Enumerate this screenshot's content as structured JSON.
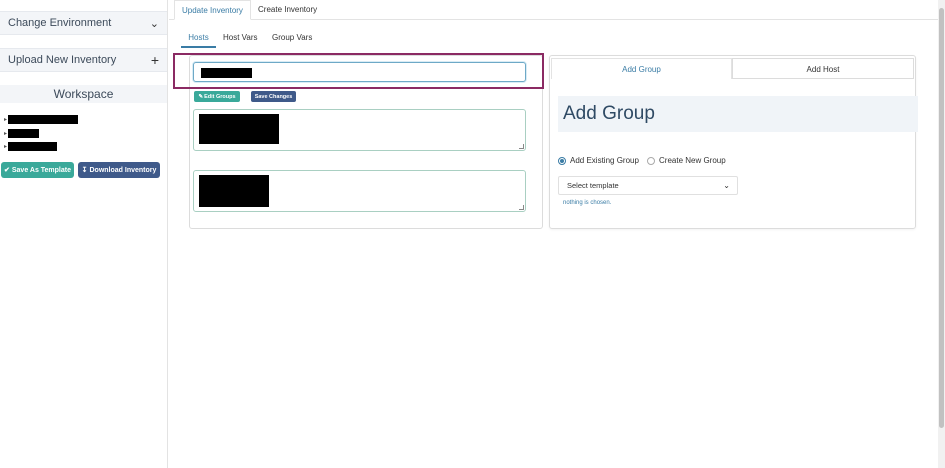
{
  "sidebar": {
    "change_environment": "Change Environment",
    "change_environment_icon": "chevron-down-icon",
    "upload_new_inventory": "Upload New Inventory",
    "upload_icon": "plus-icon",
    "workspace_title": "Workspace",
    "workspace_items": [
      "",
      "",
      ""
    ],
    "save_template_label": "Save As Template",
    "download_inventory_label": "Download Inventory"
  },
  "tabs": {
    "update_inventory": "Update Inventory",
    "create_inventory": "Create Inventory"
  },
  "subtabs": {
    "hosts": "Hosts",
    "host_vars": "Host Vars",
    "group_vars": "Group Vars"
  },
  "left_panel": {
    "host_input_value": "",
    "edit_groups_label": "Edit Groups",
    "save_changes_label": "Save Changes"
  },
  "right_panel": {
    "tab_add_group": "Add Group",
    "tab_add_host": "Add Host",
    "heading": "Add Group",
    "radio_existing": "Add Existing Group",
    "radio_new": "Create New Group",
    "select_placeholder": "Select template",
    "hint": "nothing is chosen."
  },
  "colors": {
    "accent": "#3a7ca5",
    "teal_button": "#3aa99a",
    "navy_button": "#3f5a8a",
    "highlight_border": "#8b2a63"
  }
}
